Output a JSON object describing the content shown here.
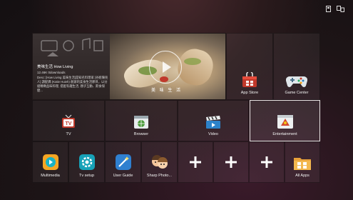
{
  "status_bar": {
    "icons": [
      "storage-icon",
      "network-icon"
    ]
  },
  "featured": {
    "title": "美味生活 How Living",
    "meta": "12.46K  0downloads",
    "description": "Desc: [How Living 美味生活]是知名料理家 [谷姐陳兆人] 讀配偶 (Katie Huieh) 創辦的美食生活節目，以分組精緻品味料理, 搭配有趣生活, 親子互動、飲食保健...",
    "caption": "美 味 生 活"
  },
  "tiles": {
    "app_store": "App Store",
    "game_center": "Game Center",
    "tv": "TV",
    "browser": "Browser",
    "video": "Video",
    "entertainment": "Entertainment",
    "multimedia": "Multimedia",
    "tv_setup": "Tv setup",
    "user_guide": "User Guide",
    "sharp_photo": "Sharp Photo...",
    "all_apps": "All Apps"
  },
  "colors": {
    "tv_red": "#c0392b",
    "accent_teal": "#1aa6b3",
    "accent_orange": "#f0a020"
  }
}
